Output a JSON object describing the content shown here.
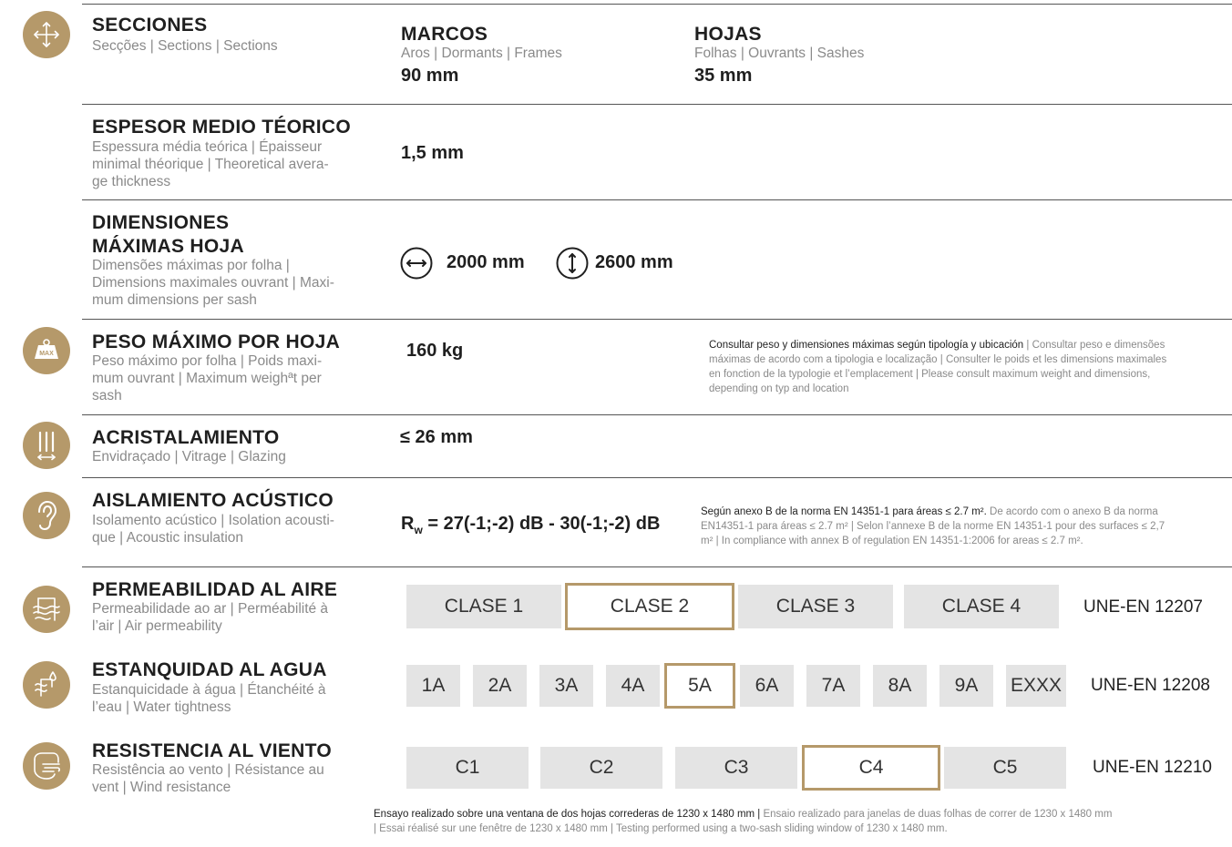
{
  "colors": {
    "accent": "#b5996a",
    "box_bg": "#e4e4e4",
    "muted": "#8a8a8a",
    "text": "#1f1f1f"
  },
  "secciones": {
    "icon": "move-arrows-icon",
    "title": "SECCIONES",
    "subtitle": "Secções | Sections | Sections",
    "marcos": {
      "title": "MARCOS",
      "subtitle": "Aros | Dormants | Frames",
      "value": "90 mm"
    },
    "hojas": {
      "title": "HOJAS",
      "subtitle": "Folhas | Ouvrants | Sashes",
      "value": "35 mm"
    }
  },
  "espesor": {
    "title": "ESPESOR MEDIO TÉORICO",
    "subtitle": [
      "Espessura média teórica | Épaisseur",
      "minimal théorique | Theoretical avera-",
      "ge thickness"
    ],
    "value": "1,5 mm"
  },
  "dimensiones": {
    "title": [
      "DIMENSIONES",
      "MÁXIMAS HOJA"
    ],
    "subtitle": [
      "Dimensões máximas por folha |",
      "Dimensions maximales ouvrant | Maxi-",
      "mum dimensions per sash"
    ],
    "width_icon": "horizontal-arrows-icon",
    "width": "2000 mm",
    "height_icon": "vertical-arrows-icon",
    "height": "2600 mm"
  },
  "peso": {
    "icon": "weight-max-icon",
    "icon_text": "MAX",
    "title": "PESO MÁXIMO POR HOJA",
    "subtitle": [
      "Peso máximo por folha | Poids maxi-",
      "mum ouvrant | Maximum weighªt per",
      "sash"
    ],
    "value": "160 kg",
    "note_dark": "Consultar peso y dimensiones máximas según tipología y ubicación",
    "note_lines": [
      " | Consultar peso e dimensões",
      "máximas de acordo com a tipologia e localização | Consulter le poids et les dimensions maximales",
      "en fonction de la typologie et l’emplacement | Please consult maximum weight and dimensions,",
      "depending on typ and location"
    ]
  },
  "acristalamiento": {
    "icon": "glazing-panes-icon",
    "title": "ACRISTALAMIENTO",
    "subtitle": "Envidraçado | Vitrage | Glazing",
    "value": "≤ 26 mm"
  },
  "aislamiento": {
    "icon": "ear-icon",
    "title": "AISLAMIENTO ACÚSTICO",
    "subtitle": [
      "Isolamento acústico | Isolation acousti-",
      "que | Acoustic insulation"
    ],
    "value_r": "R",
    "value_sub": "w",
    "value_rest": " = 27(-1;-2) dB - 30(-1;-2) dB",
    "note_dark": "Según anexo B de la norma EN 14351-1 para áreas ≤ 2.7 m².",
    "note_lines": [
      " De acordo com o anexo B da norma",
      "EN14351-1 para áreas ≤ 2.7 m² | Selon l’annexe B de la norme EN 14351-1 pour des surfaces ≤ 2,7",
      "m² | In compliance with annex B of regulation EN 14351-1:2006 for areas ≤ 2.7 m²."
    ]
  },
  "permeabilidad": {
    "icon": "air-flow-icon",
    "title": "PERMEABILIDAD AL AIRE",
    "subtitle": [
      "Permeabilidade ao ar | Perméabilité à",
      "l’air | Air permeability"
    ],
    "classes": [
      "CLASE 1",
      "CLASE 2",
      "CLASE 3",
      "CLASE 4"
    ],
    "selected": "CLASE 2",
    "standard": "UNE-EN 12207"
  },
  "estanquidad": {
    "icon": "water-drop-icon",
    "title": "ESTANQUIDAD AL AGUA",
    "subtitle": [
      "Estanquicidade à água | Étanchéité à",
      "l’eau | Water tightness"
    ],
    "classes": [
      "1A",
      "2A",
      "3A",
      "4A",
      "5A",
      "6A",
      "7A",
      "8A",
      "9A",
      "EXXX"
    ],
    "selected": "5A",
    "standard": "UNE-EN 12208"
  },
  "viento": {
    "icon": "wind-icon",
    "title": "RESISTENCIA AL VIENTO",
    "subtitle": [
      "Resistência ao vento | Résistance au",
      "vent | Wind resistance"
    ],
    "classes": [
      "C1",
      "C2",
      "C3",
      "C4",
      "C5"
    ],
    "selected": "C4",
    "standard": "UNE-EN 12210"
  },
  "footer": {
    "dark": "Ensayo realizado sobre una ventana de dos hojas correderas de 1230 x 1480 mm |",
    "line1": " Ensaio realizado para janelas de duas folhas de correr de 1230 x 1480 mm",
    "line2": " | Essai réalisé sur une fenêtre de 1230 x 1480 mm | Testing performed using a two-sash sliding window of 1230 x 1480 mm."
  }
}
